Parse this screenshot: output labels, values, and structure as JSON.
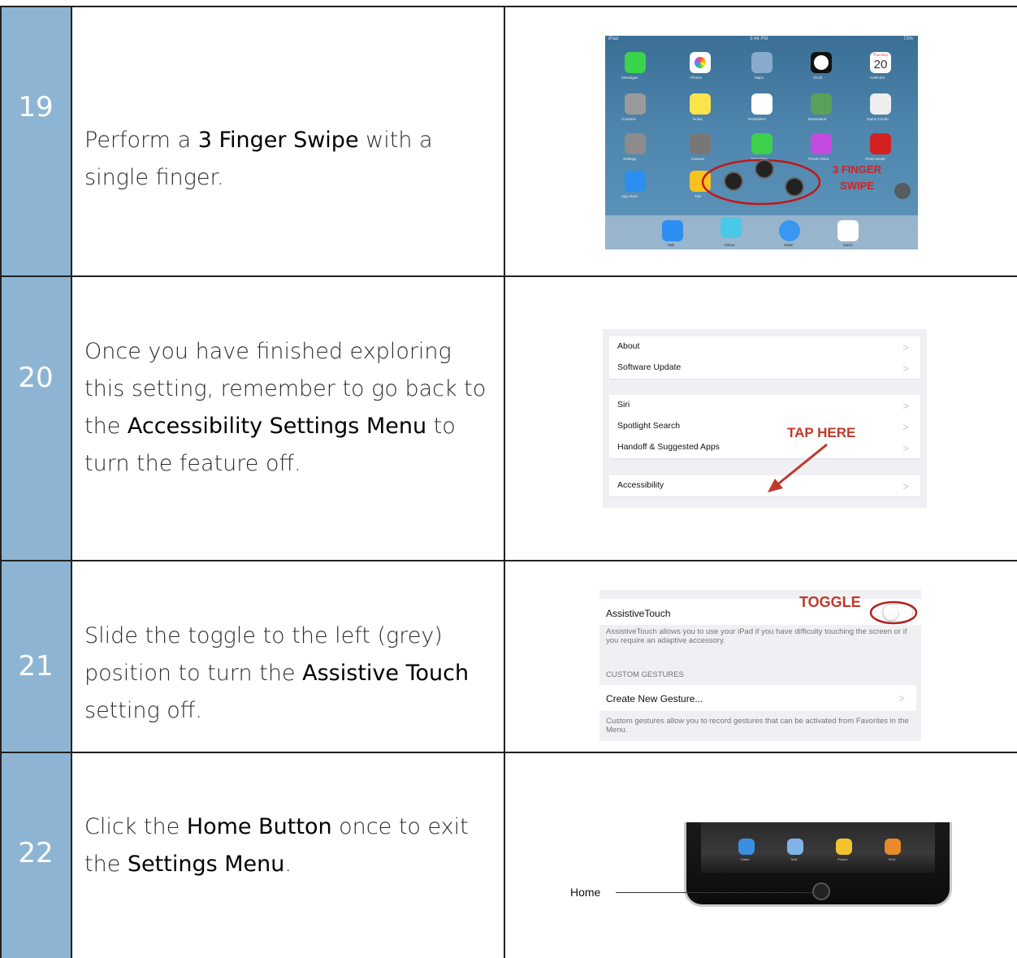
{
  "rows": [
    {
      "number": "19",
      "text_before": "Perform a ",
      "bold1": "3 Finger Swipe",
      "text_after": " with a single finger.",
      "screenshot": {
        "status_left": "iPad",
        "status_center": "3:44 PM",
        "status_right": "73%",
        "app_labels": [
          "Messages",
          "Photos",
          "Maps",
          "Clock",
          "Calendar",
          "Contacts",
          "Notes",
          "Reminders",
          "Newsstand",
          "Game Center",
          "Settings",
          "Camera",
          "FaceTime",
          "iTunes Store",
          "Photo Booth",
          "App Store",
          "Tips"
        ],
        "calendar_day": "Thursday",
        "calendar_date": "20",
        "dock_labels": [
          "Mail",
          "Videos",
          "Safari",
          "Music"
        ],
        "annotation_line1": "3 FINGER",
        "annotation_line2": "SWIPE",
        "annotation_color": "#d42020"
      }
    },
    {
      "number": "20",
      "text_before": "Once you have finished exploring this setting, remember to go back to the ",
      "bold1": "Accessibility Settings Menu",
      "text_after": " to turn the feature off.",
      "screenshot": {
        "group1": [
          "About",
          "Software Update"
        ],
        "group2": [
          "Siri",
          "Spotlight Search",
          "Handoff & Suggested Apps"
        ],
        "group3": [
          "Accessibility"
        ],
        "chevron": ">",
        "annotation": "TAP HERE",
        "annotation_color": "#c0392b"
      }
    },
    {
      "number": "21",
      "text_before": "Slide the toggle to the left (grey) position to turn the ",
      "bold1": "Assistive Touch",
      "text_after": " setting off.",
      "screenshot": {
        "row_title": "AssistiveTouch",
        "row_desc": "AssistiveTouch allows you to use your iPad if you have difficulty touching the screen or if you require an adaptive accessory.",
        "section_header": "CUSTOM GESTURES",
        "row2_title": "Create New Gesture...",
        "row2_desc": "Custom gestures allow you to record gestures that can be activated from Favorites in the Menu.",
        "chevron": ">",
        "annotation": "TOGGLE",
        "annotation_color": "#c0392b"
      }
    },
    {
      "number": "22",
      "text_before": "Click the ",
      "bold1": "Home Button",
      "text_middle": " once to exit the ",
      "bold2": "Settings Menu",
      "text_after": ".",
      "screenshot": {
        "callout_label": "Home",
        "dock_labels": [
          "Safari",
          "Mail",
          "Photos",
          "iPod"
        ]
      }
    }
  ],
  "colors": {
    "number_cell": "#8db5d3",
    "border": "#222222"
  }
}
